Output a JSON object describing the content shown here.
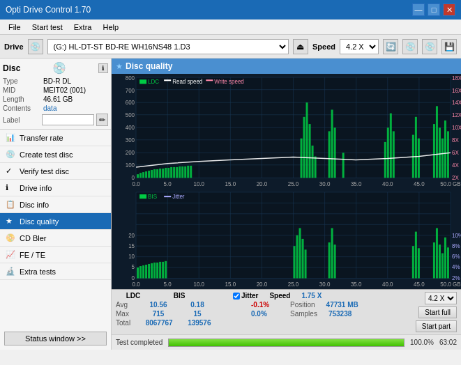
{
  "app": {
    "title": "Opti Drive Control 1.70",
    "titlebar_controls": [
      "—",
      "□",
      "✕"
    ]
  },
  "menu": {
    "items": [
      "File",
      "Start test",
      "Extra",
      "Help"
    ]
  },
  "drivebar": {
    "label": "Drive",
    "drive_value": "(G:)  HL-DT-ST BD-RE  WH16NS48 1.D3",
    "speed_label": "Speed",
    "speed_value": "4.2 X"
  },
  "disc": {
    "label": "Disc",
    "type_label": "Type",
    "type_value": "BD-R DL",
    "mid_label": "MID",
    "mid_value": "MEIT02 (001)",
    "length_label": "Length",
    "length_value": "46.61 GB",
    "contents_label": "Contents",
    "contents_value": "data",
    "label_label": "Label",
    "label_placeholder": ""
  },
  "nav": {
    "items": [
      {
        "id": "transfer-rate",
        "label": "Transfer rate",
        "icon": "📊",
        "active": false
      },
      {
        "id": "create-test-disc",
        "label": "Create test disc",
        "icon": "💿",
        "active": false
      },
      {
        "id": "verify-test-disc",
        "label": "Verify test disc",
        "icon": "✓",
        "active": false
      },
      {
        "id": "drive-info",
        "label": "Drive info",
        "icon": "ℹ",
        "active": false
      },
      {
        "id": "disc-info",
        "label": "Disc info",
        "icon": "📋",
        "active": false
      },
      {
        "id": "disc-quality",
        "label": "Disc quality",
        "icon": "★",
        "active": true
      },
      {
        "id": "cd-bler",
        "label": "CD Bler",
        "icon": "📀",
        "active": false
      },
      {
        "id": "fe-te",
        "label": "FE / TE",
        "icon": "📈",
        "active": false
      },
      {
        "id": "extra-tests",
        "label": "Extra tests",
        "icon": "🔬",
        "active": false
      }
    ],
    "status_btn": "Status window >>"
  },
  "chart": {
    "title": "Disc quality",
    "legend_top": [
      "LDC",
      "Read speed",
      "Write speed"
    ],
    "legend_bottom": [
      "BIS",
      "Jitter"
    ],
    "top_y_left_max": 800,
    "top_y_right_max": 18,
    "top_x_max": 50,
    "bottom_y_left_max": 20,
    "bottom_y_right_max": 10,
    "bottom_x_max": 50
  },
  "stats": {
    "headers": [
      "LDC",
      "BIS",
      "",
      "Jitter",
      "Speed",
      ""
    ],
    "avg_label": "Avg",
    "avg_ldc": "10.56",
    "avg_bis": "0.18",
    "avg_jitter": "-0.1%",
    "max_label": "Max",
    "max_ldc": "715",
    "max_bis": "15",
    "max_jitter": "0.0%",
    "total_label": "Total",
    "total_ldc": "8067767",
    "total_bis": "139576",
    "jitter_checked": true,
    "speed_label": "Speed",
    "speed_value": "1.75 X",
    "position_label": "Position",
    "position_value": "47731 MB",
    "samples_label": "Samples",
    "samples_value": "753238",
    "speed_select": "4.2 X",
    "start_full_btn": "Start full",
    "start_part_btn": "Start part"
  },
  "statusbar": {
    "status_text": "Test completed",
    "progress_pct": 100,
    "progress_display": "100.0%",
    "time_display": "63:02"
  }
}
